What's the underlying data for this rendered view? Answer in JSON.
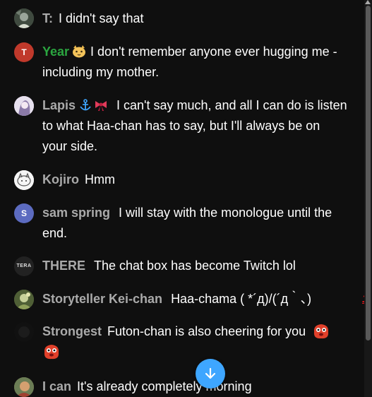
{
  "messages": [
    {
      "author": "T:",
      "text": "I didn't say that",
      "avatar": "photo",
      "avatar_color": "#4a5a4a"
    },
    {
      "author": "Year",
      "text": "I don't remember anyone ever hugging me - including my mother.",
      "avatar": "letter",
      "avatar_letter": "T",
      "avatar_color": "#c0392b",
      "author_color": "#2ba640",
      "badge": "cat-face-emoji"
    },
    {
      "author": "Lapis",
      "text": "I can't say much, and all I can do is listen to what Haa-chan has to say, but I'll always be on your side.",
      "avatar": "photo",
      "avatar_color": "#c9b5d8",
      "badges": [
        "anchor-emoji",
        "ribbon-emoji"
      ]
    },
    {
      "author": "Kojiro",
      "text": "Hmm",
      "avatar": "photo",
      "avatar_color": "#f2f2f2"
    },
    {
      "author": "sam spring",
      "text": "I will stay with the monologue until the end.",
      "avatar": "letter",
      "avatar_letter": "S",
      "avatar_color": "#5c6bc0"
    },
    {
      "author": "THERE",
      "text": "The chat box has become Twitch lol",
      "avatar": "logo",
      "avatar_letter": "TERA",
      "avatar_color": "#222222"
    },
    {
      "author": "Storyteller Kei-chan",
      "text": "Haa-chama ( *´д)/(´д｀､)",
      "avatar": "photo",
      "avatar_color": "#5b6b3a"
    },
    {
      "author": "Strongest",
      "text": "Futon-chan is also cheering for you",
      "avatar": "photo",
      "avatar_color": "#151515",
      "emoji": "red-blob-emoji"
    },
    {
      "author": "I can",
      "text": "It's already completely morning",
      "avatar": "photo",
      "avatar_color": "#7a6a4a"
    }
  ],
  "colors": {
    "background": "#0f0f0f",
    "author_default": "#aaaaaa",
    "author_member": "#2ba640",
    "text": "#ffffff",
    "scroll_button": "#3ea6ff",
    "emoji_red": "#e0402a"
  },
  "icons": {
    "scroll_down": "arrow-down-icon",
    "hundred": "hundred-points-emoji"
  },
  "deco_100": "100"
}
